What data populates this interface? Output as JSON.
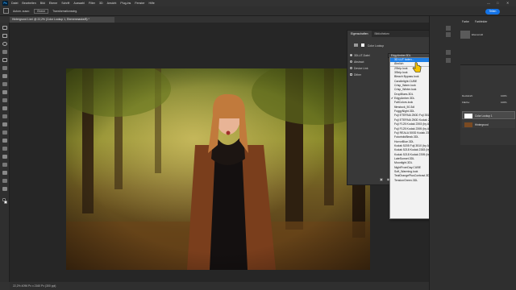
{
  "app": {
    "logo": "Ps",
    "menu": [
      "Datei",
      "Bearbeiten",
      "Bild",
      "Ebene",
      "Schrift",
      "Auswahl",
      "Filter",
      "3D",
      "Ansicht",
      "Plug-ins",
      "Fenster",
      "Hilfe"
    ]
  },
  "options_bar": {
    "auto_select": "Autom. ausw.:",
    "auto_select_value": "Ebene",
    "transform_controls": "Transformationsstrg.",
    "share_label": "Teilen"
  },
  "document": {
    "tab_title": "Hintergrund 1.tml @ 22,2% (Color Lookup 1, Ebenenmaske/8) *"
  },
  "status_bar": {
    "text": "22,2%    4096 Px x 2160 Px (300 ppi)"
  },
  "properties": {
    "tabs": [
      "Eigenschaften",
      "Bibliotheken"
    ],
    "panel_title": "Color Lookup",
    "options": {
      "lut_file_label": "3DLUT-Datei",
      "lut_file_value": "EdgyAmber.3DL",
      "abstract_label": "Abstract",
      "device_link_label": "Device Link",
      "dither_label": "Dither"
    }
  },
  "lut_dropdown": {
    "selected": "EdgyAmber.3DL",
    "items": [
      {
        "label": "3D LUT laden...",
        "highlight": true
      },
      {
        "label": "Ähnlich",
        "sep": true
      },
      {
        "label": "2Strip.look"
      },
      {
        "label": "3Strip.look"
      },
      {
        "label": "Bleach Bypass.look"
      },
      {
        "label": "Candlelight.CUBE"
      },
      {
        "label": "Crisp_Warm.look"
      },
      {
        "label": "Crisp_Winter.look"
      },
      {
        "label": "DropBlues.3DL"
      },
      {
        "label": "EdgyAmber.3DL",
        "checked": true
      },
      {
        "label": "FallColors.look"
      },
      {
        "label": "filmstock_50.3dl"
      },
      {
        "label": "FoggyNight.3DL"
      },
      {
        "label": "Fuji ETERNA 250D Fuji 3510 (by Adobe).cube"
      },
      {
        "label": "Fuji ETERNA 250D Kodak 2395 (by Adobe).cube"
      },
      {
        "label": "Fuji F125 Kodak 2393 (by Adobe).cube"
      },
      {
        "label": "Fuji F125 Kodak 2395 (by Adobe).cube"
      },
      {
        "label": "Fuji REALA 500D Kodak 2393 (by Adobe).cube"
      },
      {
        "label": "FuturisticBleak.3DL"
      },
      {
        "label": "HorrorBlue.3DL"
      },
      {
        "label": "Kodak 5205 Fuji 3510 (by Adobe).cube"
      },
      {
        "label": "Kodak 5218 Kodak 2383 (by Adobe).cube"
      },
      {
        "label": "Kodak 5218 Kodak 2395 (by Adobe).cube"
      },
      {
        "label": "LateSunset.3DL"
      },
      {
        "label": "Moonlight.3DL"
      },
      {
        "label": "NightFromDay.CUBE"
      },
      {
        "label": "Soft_Warming.look"
      },
      {
        "label": "TealOrangePlusContrast.3DL"
      },
      {
        "label": "TensionGreen.3DL"
      }
    ]
  },
  "right_panel": {
    "top_tabs": [
      "Farbe",
      "Farbfelder"
    ],
    "mid_label": "Ebenenstil",
    "opacity_label": "Deckkraft:",
    "opacity_value": "100%",
    "fill_label": "Fläche:",
    "fill_value": "100%",
    "layer1": "Color Lookup 1",
    "layer2": "Hintergrund"
  },
  "colors": {
    "accent": "#1473e6",
    "highlight": "#1e7fe6"
  }
}
